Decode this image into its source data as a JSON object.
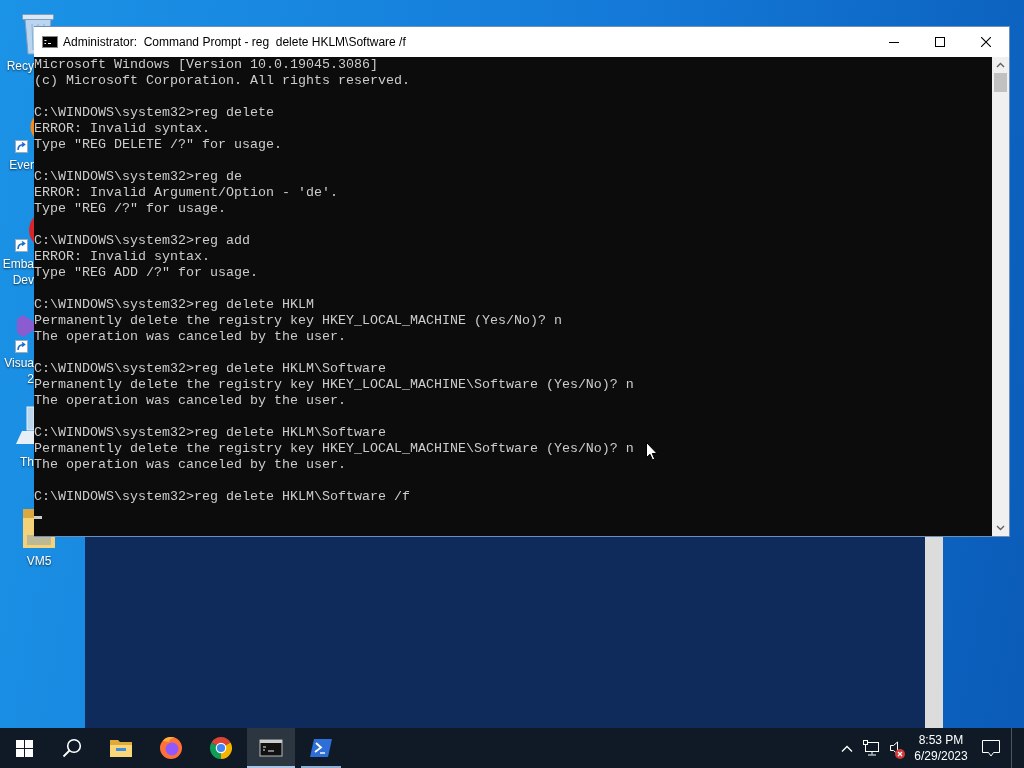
{
  "desktop": {
    "icons": [
      {
        "kind": "recycle-bin",
        "label": [
          "Recy"
        ]
      },
      {
        "kind": "search-app",
        "label": [
          "Ever"
        ]
      },
      {
        "kind": "ide",
        "label": [
          "Emba",
          "Dev"
        ]
      },
      {
        "kind": "studio",
        "label": [
          "Visua",
          "2"
        ]
      },
      {
        "kind": "computer",
        "label": [
          "Th"
        ]
      },
      {
        "kind": "folder",
        "label": [
          "VM5"
        ]
      }
    ]
  },
  "window": {
    "title": "Administrator:  Command Prompt - reg  delete HKLM\\Software /f"
  },
  "console": {
    "blocks": [
      {
        "lines": [
          "Microsoft Windows [Version 10.0.19045.3086]",
          "(c) Microsoft Corporation. All rights reserved."
        ]
      },
      {
        "lines": [
          "C:\\WINDOWS\\system32>reg delete",
          "ERROR: Invalid syntax.",
          "Type \"REG DELETE /?\" for usage."
        ]
      },
      {
        "lines": [
          "C:\\WINDOWS\\system32>reg de",
          "ERROR: Invalid Argument/Option - 'de'.",
          "Type \"REG /?\" for usage."
        ]
      },
      {
        "lines": [
          "C:\\WINDOWS\\system32>reg add",
          "ERROR: Invalid syntax.",
          "Type \"REG ADD /?\" for usage."
        ]
      },
      {
        "lines": [
          "C:\\WINDOWS\\system32>reg delete HKLM",
          "Permanently delete the registry key HKEY_LOCAL_MACHINE (Yes/No)? n",
          "The operation was canceled by the user."
        ]
      },
      {
        "lines": [
          "C:\\WINDOWS\\system32>reg delete HKLM\\Software",
          "Permanently delete the registry key HKEY_LOCAL_MACHINE\\Software (Yes/No)? n",
          "The operation was canceled by the user."
        ]
      },
      {
        "lines": [
          "C:\\WINDOWS\\system32>reg delete HKLM\\Software",
          "Permanently delete the registry key HKEY_LOCAL_MACHINE\\Software (Yes/No)? n",
          "The operation was canceled by the user."
        ]
      },
      {
        "lines": [
          "C:\\WINDOWS\\system32>reg delete HKLM\\Software /f"
        ]
      }
    ],
    "cursor": true
  },
  "taskbar": {
    "apps": [
      {
        "kind": "folder",
        "running": false,
        "selected": false
      },
      {
        "kind": "fox",
        "running": false,
        "selected": false
      },
      {
        "kind": "browser",
        "running": false,
        "selected": false
      },
      {
        "kind": "console",
        "running": true,
        "selected": true
      },
      {
        "kind": "shell",
        "running": true,
        "selected": false
      }
    ],
    "tray": {
      "volume_muted": true
    },
    "clock": {
      "time": "8:53 PM",
      "date": "6/29/2023"
    }
  }
}
